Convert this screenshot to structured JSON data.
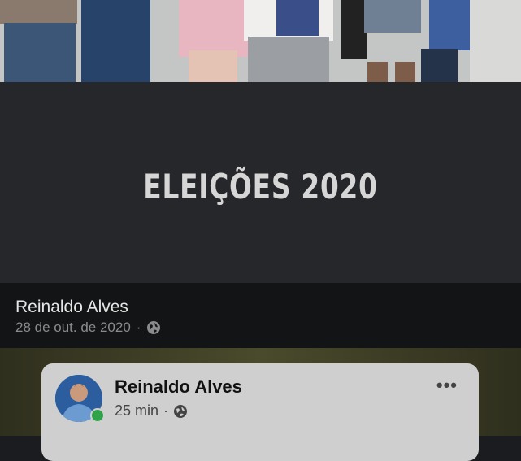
{
  "post": {
    "banner_title": "ELEIÇÕES 2020",
    "author": "Reinaldo Alves",
    "date": "28 de out. de 2020",
    "separator": "·",
    "privacy_icon": "globe-icon"
  },
  "shared_post": {
    "author": "Reinaldo Alves",
    "time": "25 min",
    "separator": "·",
    "privacy_icon": "globe-icon",
    "more_label": "•••",
    "online_status_color": "#31a24c"
  }
}
